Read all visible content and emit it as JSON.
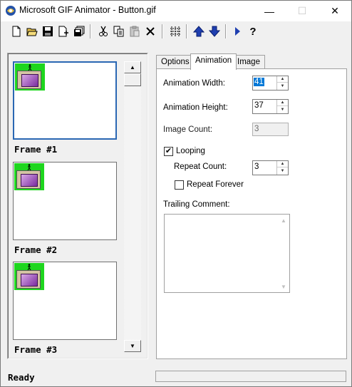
{
  "window": {
    "title": "Microsoft GIF Animator - Button.gif",
    "controls": {
      "minimize": "—",
      "maximize": "☐",
      "close": "✕"
    }
  },
  "toolbar": {
    "buttons": [
      {
        "name": "new-icon"
      },
      {
        "name": "open-icon"
      },
      {
        "name": "save-icon"
      },
      {
        "name": "insert-icon"
      },
      {
        "name": "save-as-icon"
      },
      {
        "name": "cut-icon"
      },
      {
        "name": "copy-icon"
      },
      {
        "name": "paste-icon"
      },
      {
        "name": "delete-icon"
      },
      {
        "name": "select-all-icon"
      },
      {
        "name": "move-up-icon"
      },
      {
        "name": "move-down-icon"
      },
      {
        "name": "preview-icon"
      },
      {
        "name": "help-icon"
      }
    ],
    "help_label": "?"
  },
  "frames": [
    {
      "label": "Frame #1",
      "selected": true
    },
    {
      "label": "Frame #2",
      "selected": false
    },
    {
      "label": "Frame #3",
      "selected": false
    }
  ],
  "tabs": {
    "options": "Options",
    "animation": "Animation",
    "image": "Image",
    "active": "Animation"
  },
  "animation": {
    "width_label": "Animation Width:",
    "width_value": "41",
    "height_label": "Animation Height:",
    "height_value": "37",
    "image_count_label": "Image Count:",
    "image_count_value": "3",
    "looping_label": "Looping",
    "looping_checked": true,
    "repeat_count_label": "Repeat Count:",
    "repeat_count_value": "3",
    "repeat_forever_label": "Repeat Forever",
    "repeat_forever_checked": false,
    "trailing_comment_label": "Trailing Comment:",
    "trailing_comment_value": ""
  },
  "status": {
    "text": "Ready"
  },
  "colors": {
    "selection_border": "#2a67b3",
    "thumbnail_background": "#1ed61e",
    "selected_text_bg": "#0078d7"
  }
}
